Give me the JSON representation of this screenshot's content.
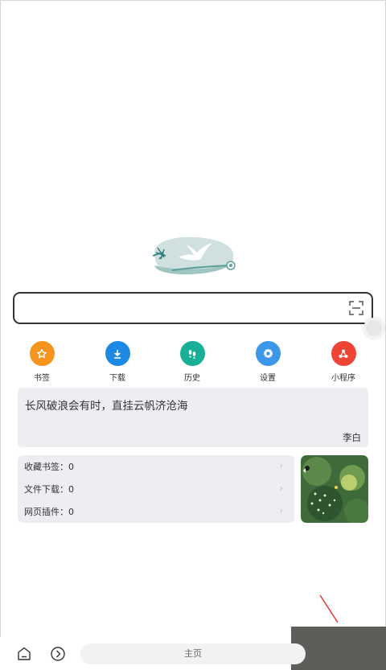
{
  "logo": {
    "name": "seagull-logo-icon"
  },
  "search": {
    "value": "",
    "icon": "scan-icon"
  },
  "quick_actions": [
    {
      "label": "书签",
      "icon": "star-icon",
      "color": "#f7941d"
    },
    {
      "label": "下载",
      "icon": "download-icon",
      "color": "#1e88e5"
    },
    {
      "label": "历史",
      "icon": "footprints-icon",
      "color": "#17b096"
    },
    {
      "label": "设置",
      "icon": "gear-icon",
      "color": "#3c97e8"
    },
    {
      "label": "小程序",
      "icon": "mini-program-icon",
      "color": "#ee4436"
    }
  ],
  "quote": {
    "text": "长风破浪会有时，直挂云帆济沧海",
    "author": "李白"
  },
  "stats": [
    {
      "label": "收藏书签：0"
    },
    {
      "label": "文件下载：0"
    },
    {
      "label": "网页插件：0"
    }
  ],
  "bottom": {
    "tab_label": "主页"
  },
  "colors": {
    "card_bg": "#eceef2",
    "annotation": "#e53935"
  }
}
